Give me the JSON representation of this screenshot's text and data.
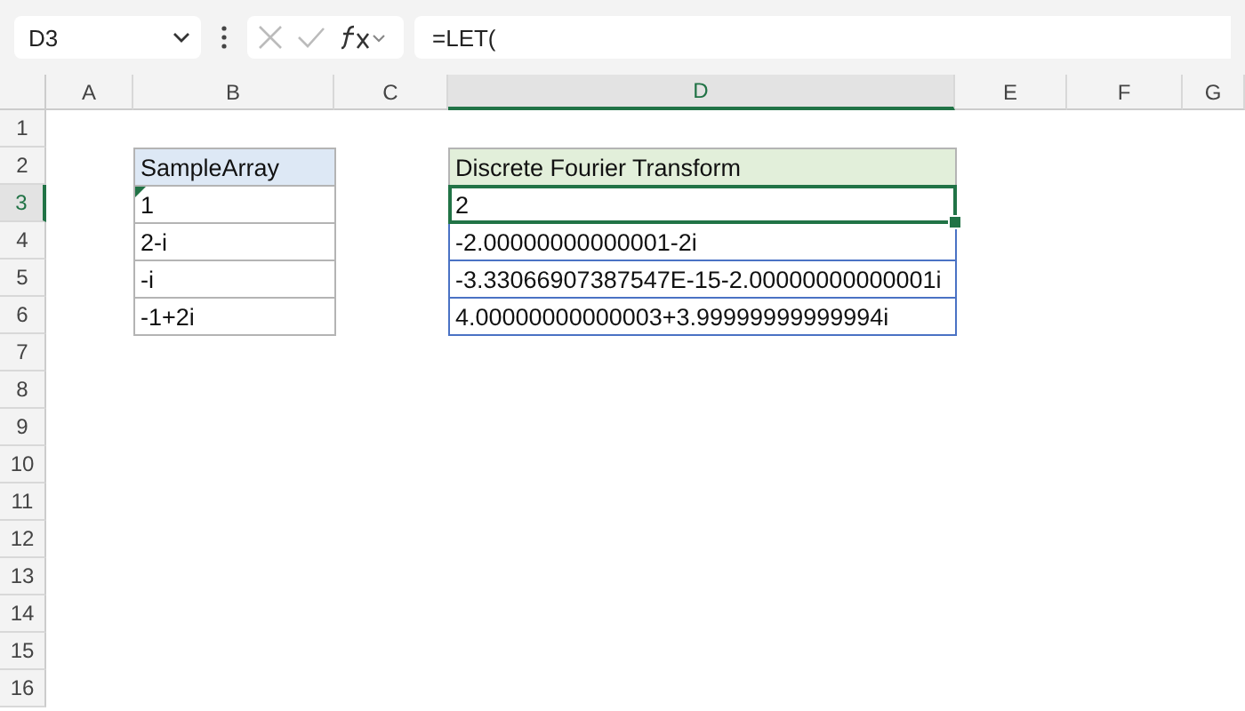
{
  "name_box": "D3",
  "formula": "=LET(",
  "columns": [
    {
      "label": "A",
      "selected": false
    },
    {
      "label": "B",
      "selected": false
    },
    {
      "label": "C",
      "selected": false
    },
    {
      "label": "D",
      "selected": true
    },
    {
      "label": "E",
      "selected": false
    },
    {
      "label": "F",
      "selected": false
    },
    {
      "label": "G",
      "selected": false
    }
  ],
  "rows": [
    {
      "label": "1",
      "selected": false
    },
    {
      "label": "2",
      "selected": false
    },
    {
      "label": "3",
      "selected": true
    },
    {
      "label": "4",
      "selected": false
    },
    {
      "label": "5",
      "selected": false
    },
    {
      "label": "6",
      "selected": false
    },
    {
      "label": "7",
      "selected": false
    },
    {
      "label": "8",
      "selected": false
    },
    {
      "label": "9",
      "selected": false
    },
    {
      "label": "10",
      "selected": false
    },
    {
      "label": "11",
      "selected": false
    },
    {
      "label": "12",
      "selected": false
    },
    {
      "label": "13",
      "selected": false
    },
    {
      "label": "14",
      "selected": false
    },
    {
      "label": "15",
      "selected": false
    },
    {
      "label": "16",
      "selected": false
    }
  ],
  "tables": [
    {
      "header": "SampleArray",
      "cells": [
        {
          "text": "1",
          "selected": false,
          "flag": true
        },
        {
          "text": "2-i",
          "selected": false,
          "flag": false
        },
        {
          "text": "-i",
          "selected": false,
          "flag": false
        },
        {
          "text": "-1+2i",
          "selected": false,
          "flag": false
        }
      ]
    },
    {
      "header": "Discrete Fourier Transform",
      "cells": [
        {
          "text": "2",
          "selected": true,
          "flag": false
        },
        {
          "text": "-2.00000000000001-2i",
          "selected": false,
          "flag": false
        },
        {
          "text": "-3.33066907387547E-15-2.00000000000001i",
          "selected": false,
          "flag": false
        },
        {
          "text": "4.00000000000003+3.99999999999994i",
          "selected": false,
          "flag": false
        }
      ]
    }
  ]
}
